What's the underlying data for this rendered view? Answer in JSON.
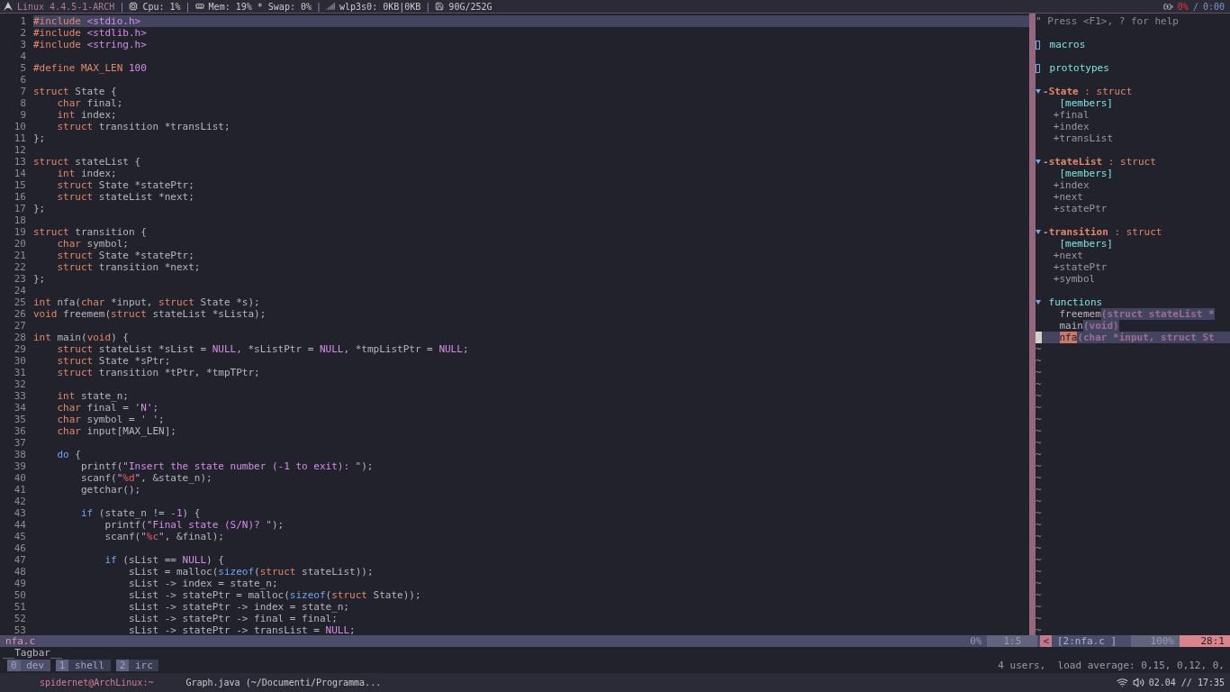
{
  "top_bar": {
    "segments": [
      {
        "kind": "logo",
        "text": "Linux 4.4.5-1-ARCH"
      },
      {
        "kind": "cpu",
        "separator": "|",
        "text": "Cpu: 1%"
      },
      {
        "kind": "mem",
        "separator": "|",
        "text": "Mem: 19% * Swap: 0%"
      },
      {
        "kind": "net",
        "separator": "|",
        "text": "wlp3s0: 0KB|0KB"
      },
      {
        "kind": "disk",
        "separator": "|",
        "text": "90G/252G"
      }
    ],
    "battery": "0%",
    "slash": "/",
    "timer": "0:00"
  },
  "editor": {
    "lines": [
      {
        "num": "1",
        "current": true,
        "tokens": [
          {
            "text": "#include ",
            "kind": "pre"
          },
          {
            "text": "<stdio.h>",
            "kind": "str"
          }
        ]
      },
      {
        "num": "2",
        "current": false,
        "tokens": [
          {
            "text": "#include ",
            "kind": "pre"
          },
          {
            "text": "<stdlib.h>",
            "kind": "str"
          }
        ]
      },
      {
        "num": "3",
        "current": false,
        "tokens": [
          {
            "text": "#include ",
            "kind": "pre"
          },
          {
            "text": "<string.h>",
            "kind": "str"
          }
        ]
      },
      {
        "num": "4",
        "current": false
      },
      {
        "num": "5",
        "current": false,
        "tokens": [
          {
            "text": "#define MAX_LEN ",
            "kind": "pre"
          },
          {
            "text": "100",
            "kind": "num"
          }
        ]
      },
      {
        "num": "6",
        "current": false
      },
      {
        "num": "7",
        "current": false,
        "tokens": [
          {
            "text": "struct",
            "kind": "kw"
          },
          {
            "text": " State {",
            "kind": "plain"
          }
        ]
      },
      {
        "num": "8",
        "current": false,
        "tokens": [
          {
            "text": "    char",
            "kind": "kw"
          },
          {
            "text": " final;",
            "kind": "plain"
          }
        ]
      },
      {
        "num": "9",
        "current": false,
        "tokens": [
          {
            "text": "    int",
            "kind": "kw"
          },
          {
            "text": " index;",
            "kind": "plain"
          }
        ]
      },
      {
        "num": "10",
        "current": false,
        "tokens": [
          {
            "text": "    struct",
            "kind": "kw"
          },
          {
            "text": " transition *transList;",
            "kind": "plain"
          }
        ]
      },
      {
        "num": "11",
        "current": false,
        "tokens": [
          {
            "text": "};",
            "kind": "plain"
          }
        ]
      },
      {
        "num": "12",
        "current": false
      },
      {
        "num": "13",
        "current": false,
        "tokens": [
          {
            "text": "struct",
            "kind": "kw"
          },
          {
            "text": " stateList {",
            "kind": "plain"
          }
        ]
      },
      {
        "num": "14",
        "current": false,
        "tokens": [
          {
            "text": "    int",
            "kind": "kw"
          },
          {
            "text": " index;",
            "kind": "plain"
          }
        ]
      },
      {
        "num": "15",
        "current": false,
        "tokens": [
          {
            "text": "    struct",
            "kind": "kw"
          },
          {
            "text": " State *statePtr;",
            "kind": "plain"
          }
        ]
      },
      {
        "num": "16",
        "current": false,
        "tokens": [
          {
            "text": "    struct",
            "kind": "kw"
          },
          {
            "text": " stateList *next;",
            "kind": "plain"
          }
        ]
      },
      {
        "num": "17",
        "current": false,
        "tokens": [
          {
            "text": "};",
            "kind": "plain"
          }
        ]
      },
      {
        "num": "18",
        "current": false
      },
      {
        "num": "19",
        "current": false,
        "tokens": [
          {
            "text": "struct",
            "kind": "kw"
          },
          {
            "text": " transition {",
            "kind": "plain"
          }
        ]
      },
      {
        "num": "20",
        "current": false,
        "tokens": [
          {
            "text": "    char",
            "kind": "kw"
          },
          {
            "text": " symbol;",
            "kind": "plain"
          }
        ]
      },
      {
        "num": "21",
        "current": false,
        "tokens": [
          {
            "text": "    struct",
            "kind": "kw"
          },
          {
            "text": " State *statePtr;",
            "kind": "plain"
          }
        ]
      },
      {
        "num": "22",
        "current": false,
        "tokens": [
          {
            "text": "    struct",
            "kind": "kw"
          },
          {
            "text": " transition *next;",
            "kind": "plain"
          }
        ]
      },
      {
        "num": "23",
        "current": false,
        "tokens": [
          {
            "text": "};",
            "kind": "plain"
          }
        ]
      },
      {
        "num": "24",
        "current": false
      },
      {
        "num": "25",
        "current": false,
        "tokens": [
          {
            "text": "int",
            "kind": "kw"
          },
          {
            "text": " nfa(",
            "kind": "plain"
          },
          {
            "text": "char",
            "kind": "kw"
          },
          {
            "text": " *input, ",
            "kind": "plain"
          },
          {
            "text": "struct",
            "kind": "kw"
          },
          {
            "text": " State *s);",
            "kind": "plain"
          }
        ]
      },
      {
        "num": "26",
        "current": false,
        "tokens": [
          {
            "text": "void",
            "kind": "kw"
          },
          {
            "text": " freemem(",
            "kind": "plain"
          },
          {
            "text": "struct",
            "kind": "kw"
          },
          {
            "text": " stateList *sLista);",
            "kind": "plain"
          }
        ]
      },
      {
        "num": "27",
        "current": false
      },
      {
        "num": "28",
        "current": false,
        "tokens": [
          {
            "text": "int",
            "kind": "kw"
          },
          {
            "text": " main(",
            "kind": "plain"
          },
          {
            "text": "void",
            "kind": "kw"
          },
          {
            "text": ") {",
            "kind": "plain"
          }
        ]
      },
      {
        "num": "29",
        "current": false,
        "tokens": [
          {
            "text": "    struct",
            "kind": "kw"
          },
          {
            "text": " stateList *sList = ",
            "kind": "plain"
          },
          {
            "text": "NULL",
            "kind": "num"
          },
          {
            "text": ", *sListPtr = ",
            "kind": "plain"
          },
          {
            "text": "NULL",
            "kind": "num"
          },
          {
            "text": ", *tmpListPtr = ",
            "kind": "plain"
          },
          {
            "text": "NULL",
            "kind": "num"
          },
          {
            "text": ";",
            "kind": "plain"
          }
        ]
      },
      {
        "num": "30",
        "current": false,
        "tokens": [
          {
            "text": "    struct",
            "kind": "kw"
          },
          {
            "text": " State *sPtr;",
            "kind": "plain"
          }
        ]
      },
      {
        "num": "31",
        "current": false,
        "tokens": [
          {
            "text": "    struct",
            "kind": "kw"
          },
          {
            "text": " transition *tPtr, *tmpTPtr;",
            "kind": "plain"
          }
        ]
      },
      {
        "num": "32",
        "current": false
      },
      {
        "num": "33",
        "current": false,
        "tokens": [
          {
            "text": "    int",
            "kind": "kw"
          },
          {
            "text": " state_n;",
            "kind": "plain"
          }
        ]
      },
      {
        "num": "34",
        "current": false,
        "tokens": [
          {
            "text": "    char",
            "kind": "kw"
          },
          {
            "text": " final = ",
            "kind": "plain"
          },
          {
            "text": "'N'",
            "kind": "str"
          },
          {
            "text": ";",
            "kind": "plain"
          }
        ]
      },
      {
        "num": "35",
        "current": false,
        "tokens": [
          {
            "text": "    char",
            "kind": "kw"
          },
          {
            "text": " symbol = ",
            "kind": "plain"
          },
          {
            "text": "' '",
            "kind": "str"
          },
          {
            "text": ";",
            "kind": "plain"
          }
        ]
      },
      {
        "num": "36",
        "current": false,
        "tokens": [
          {
            "text": "    char",
            "kind": "kw"
          },
          {
            "text": " input[MAX_LEN];",
            "kind": "plain"
          }
        ]
      },
      {
        "num": "37",
        "current": false
      },
      {
        "num": "38",
        "current": false,
        "tokens": [
          {
            "text": "    do",
            "kind": "flow"
          },
          {
            "text": " {",
            "kind": "plain"
          }
        ]
      },
      {
        "num": "39",
        "current": false,
        "tokens": [
          {
            "text": "        printf(",
            "kind": "plain"
          },
          {
            "text": "\"Insert the state number (-1 to exit): \"",
            "kind": "str"
          },
          {
            "text": ");",
            "kind": "plain"
          }
        ]
      },
      {
        "num": "40",
        "current": false,
        "tokens": [
          {
            "text": "        scanf(",
            "kind": "plain"
          },
          {
            "text": "\"",
            "kind": "str"
          },
          {
            "text": "%d",
            "kind": "fmt"
          },
          {
            "text": "\"",
            "kind": "str"
          },
          {
            "text": ", &state_n);",
            "kind": "plain"
          }
        ]
      },
      {
        "num": "41",
        "current": false,
        "tokens": [
          {
            "text": "        getchar();",
            "kind": "plain"
          }
        ]
      },
      {
        "num": "42",
        "current": false
      },
      {
        "num": "43",
        "current": false,
        "tokens": [
          {
            "text": "        if",
            "kind": "flow"
          },
          {
            "text": " (state_n != ",
            "kind": "plain"
          },
          {
            "text": "-1",
            "kind": "num"
          },
          {
            "text": ") {",
            "kind": "plain"
          }
        ]
      },
      {
        "num": "44",
        "current": false,
        "tokens": [
          {
            "text": "            printf(",
            "kind": "plain"
          },
          {
            "text": "\"Final state (S/N)? \"",
            "kind": "str"
          },
          {
            "text": ");",
            "kind": "plain"
          }
        ]
      },
      {
        "num": "45",
        "current": false,
        "tokens": [
          {
            "text": "            scanf(",
            "kind": "plain"
          },
          {
            "text": "\"",
            "kind": "str"
          },
          {
            "text": "%c",
            "kind": "fmt"
          },
          {
            "text": "\"",
            "kind": "str"
          },
          {
            "text": ", &final);",
            "kind": "plain"
          }
        ]
      },
      {
        "num": "46",
        "current": false
      },
      {
        "num": "47",
        "current": false,
        "tokens": [
          {
            "text": "            if",
            "kind": "flow"
          },
          {
            "text": " (sList == ",
            "kind": "plain"
          },
          {
            "text": "NULL",
            "kind": "num"
          },
          {
            "text": ") {",
            "kind": "plain"
          }
        ]
      },
      {
        "num": "48",
        "current": false,
        "tokens": [
          {
            "text": "                sList = malloc(",
            "kind": "plain"
          },
          {
            "text": "sizeof",
            "kind": "flow"
          },
          {
            "text": "(",
            "kind": "plain"
          },
          {
            "text": "struct",
            "kind": "kw"
          },
          {
            "text": " stateList));",
            "kind": "plain"
          }
        ]
      },
      {
        "num": "49",
        "current": false,
        "tokens": [
          {
            "text": "                sList -> index = state_n;",
            "kind": "plain"
          }
        ]
      },
      {
        "num": "50",
        "current": false,
        "tokens": [
          {
            "text": "                sList -> statePtr = malloc(",
            "kind": "plain"
          },
          {
            "text": "sizeof",
            "kind": "flow"
          },
          {
            "text": "(",
            "kind": "plain"
          },
          {
            "text": "struct",
            "kind": "kw"
          },
          {
            "text": " State));",
            "kind": "plain"
          }
        ]
      },
      {
        "num": "51",
        "current": false,
        "tokens": [
          {
            "text": "                sList -> statePtr -> index = state_n;",
            "kind": "plain"
          }
        ]
      },
      {
        "num": "52",
        "current": false,
        "tokens": [
          {
            "text": "                sList -> statePtr -> final = final;",
            "kind": "plain"
          }
        ]
      },
      {
        "num": "53",
        "current": false,
        "tokens": [
          {
            "text": "                sList -> statePtr -> transList = ",
            "kind": "plain"
          },
          {
            "text": "NULL",
            "kind": "num"
          },
          {
            "text": ";",
            "kind": "plain"
          }
        ]
      }
    ]
  },
  "tagbar": {
    "help": "\" Press <F1>, ? for help",
    "items": [
      {
        "kind": "group",
        "label": "macros",
        "expanded": false
      },
      {
        "kind": "group",
        "label": "prototypes",
        "expanded": false
      },
      {
        "kind": "struct",
        "visibility": "-",
        "label": "State",
        "suffix": ": struct",
        "expanded": true,
        "children": [
          {
            "kind": "header",
            "label": "[members]",
            "children": [
              {
                "label": "+final"
              },
              {
                "label": "+index"
              },
              {
                "label": "+transList"
              }
            ]
          }
        ]
      },
      {
        "kind": "struct",
        "visibility": "-",
        "label": "stateList",
        "suffix": ": struct",
        "expanded": true,
        "children": [
          {
            "kind": "header",
            "label": "[members]",
            "children": [
              {
                "label": "+index"
              },
              {
                "label": "+next"
              },
              {
                "label": "+statePtr"
              }
            ]
          }
        ]
      },
      {
        "kind": "struct",
        "visibility": "-",
        "label": "transition",
        "suffix": ": struct",
        "expanded": true,
        "children": [
          {
            "kind": "header",
            "label": "[members]",
            "children": [
              {
                "label": "+next"
              },
              {
                "label": "+statePtr"
              },
              {
                "label": "+symbol"
              }
            ]
          }
        ]
      },
      {
        "kind": "group",
        "label": "functions",
        "expanded": true,
        "children": [
          {
            "kind": "function",
            "label": "freemem",
            "signature": "(struct stateList *",
            "selected": false
          },
          {
            "kind": "function",
            "label": "main",
            "signature": "(void)",
            "selected": false
          },
          {
            "kind": "function",
            "label": "nfa",
            "signature": "(char *input, struct St",
            "selected": true
          }
        ]
      }
    ],
    "filler": [
      "~",
      "~",
      "~",
      "~",
      "~",
      "~",
      "~",
      "~",
      "~",
      "~",
      "~",
      "~",
      "~",
      "~",
      "~",
      "~",
      "~",
      "~",
      "~",
      "~",
      "~",
      "~",
      "~",
      "~",
      "~"
    ]
  },
  "status_line": {
    "file": "nfa.c",
    "percent": "0%",
    "position": "1:5",
    "tagbar_arrow": "<",
    "tagbar_name": "[2:nfa.c ]",
    "tagbar_percent": "100%",
    "tagbar_position": "28:1"
  },
  "command_line": "__Tagbar__",
  "tmux": {
    "windows": [
      {
        "index": "0",
        "name": "dev",
        "selected": true
      },
      {
        "index": "1",
        "name": "shell",
        "selected": false
      },
      {
        "index": "2",
        "name": "irc",
        "selected": false
      }
    ],
    "status": "4 users,  load average: 0,15, 0,12, 0,"
  },
  "taskbar": {
    "items": [
      {
        "label": "spidernet@ArchLinux:~",
        "selected": true
      },
      {
        "label": "Graph.java (~/Documenti/Programma...",
        "selected": false
      }
    ],
    "clock": "02.04 // 17:35"
  }
}
